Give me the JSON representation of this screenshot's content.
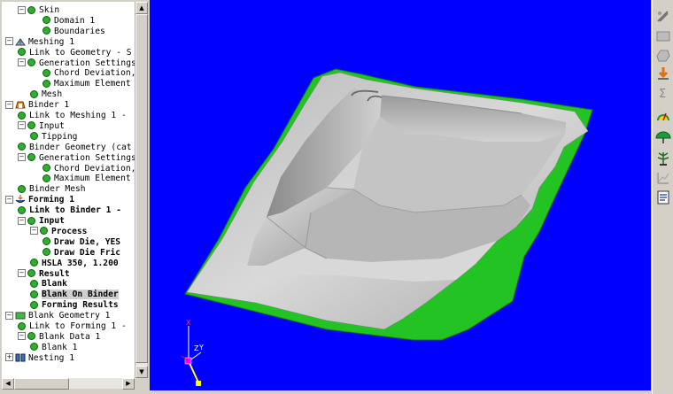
{
  "tree": {
    "items": [
      {
        "label": "Skin",
        "node": "minus",
        "icon": "green-dot-icon"
      },
      {
        "label": "Domain 1",
        "node": "none",
        "icon": "green-dot-icon"
      },
      {
        "label": "Boundaries",
        "node": "none",
        "icon": "green-dot-icon"
      },
      {
        "label": "Meshing 1",
        "node": "minus",
        "icon": "meshing-icon"
      },
      {
        "label": "Link to Geometry - S",
        "node": "none",
        "icon": "green-dot-icon"
      },
      {
        "label": "Generation Settings",
        "node": "minus",
        "icon": "green-dot-icon"
      },
      {
        "label": "Chord Deviation,",
        "node": "none",
        "icon": "green-dot-icon"
      },
      {
        "label": "Maximum Element S",
        "node": "none",
        "icon": "green-dot-icon"
      },
      {
        "label": "Mesh",
        "node": "none",
        "icon": "green-dot-icon"
      },
      {
        "label": "Binder 1",
        "node": "minus",
        "icon": "binder-icon"
      },
      {
        "label": "Link to Meshing 1 -",
        "node": "none",
        "icon": "green-dot-icon"
      },
      {
        "label": "Input",
        "node": "minus",
        "icon": "green-dot-icon"
      },
      {
        "label": "Tipping",
        "node": "none",
        "icon": "green-dot-icon"
      },
      {
        "label": "Binder Geometry (cat",
        "node": "none",
        "icon": "green-dot-icon"
      },
      {
        "label": "Generation Settings",
        "node": "minus",
        "icon": "green-dot-icon"
      },
      {
        "label": "Chord Deviation,",
        "node": "none",
        "icon": "green-dot-icon"
      },
      {
        "label": "Maximum Element S",
        "node": "none",
        "icon": "green-dot-icon"
      },
      {
        "label": "Binder Mesh",
        "node": "none",
        "icon": "green-dot-icon"
      },
      {
        "label": "Forming 1",
        "node": "minus",
        "icon": "forming-icon"
      },
      {
        "label": "Link to Binder 1 -",
        "node": "none",
        "icon": "green-dot-icon"
      },
      {
        "label": "Input",
        "node": "minus",
        "icon": "green-dot-icon"
      },
      {
        "label": "Process",
        "node": "minus",
        "icon": "green-dot-icon"
      },
      {
        "label": "Draw Die, YES",
        "node": "none",
        "icon": "green-dot-icon"
      },
      {
        "label": "Draw Die Fric",
        "node": "none",
        "icon": "green-dot-icon"
      },
      {
        "label": "HSLA 350, 1.200",
        "node": "none",
        "icon": "green-dot-icon"
      },
      {
        "label": "Result",
        "node": "minus",
        "icon": "green-dot-icon"
      },
      {
        "label": "Blank",
        "node": "none",
        "icon": "green-dot-icon"
      },
      {
        "label": "Blank On Binder",
        "node": "none",
        "icon": "green-dot-icon"
      },
      {
        "label": "Forming Results",
        "node": "none",
        "icon": "green-dot-icon"
      },
      {
        "label": "Blank Geometry 1",
        "node": "minus",
        "icon": "blank-geometry-icon"
      },
      {
        "label": "Link to Forming 1 -",
        "node": "none",
        "icon": "green-dot-icon"
      },
      {
        "label": "Blank Data 1",
        "node": "minus",
        "icon": "green-dot-icon"
      },
      {
        "label": "Blank 1",
        "node": "none",
        "icon": "green-dot-icon"
      },
      {
        "label": "Nesting 1",
        "node": "plus",
        "icon": "nesting-icon"
      }
    ]
  },
  "viewport": {
    "background": "#0000ff",
    "axis_labels": {
      "x": "X",
      "y": "Y",
      "z": "Z"
    }
  },
  "toolbar": {
    "icons": [
      "ruler-icon",
      "panel-icon",
      "shape-icon",
      "download-arrow-icon",
      "sigma-icon",
      "gauge-icon",
      "umbrella-gauge-icon",
      "tree-icon",
      "chart-icon",
      "report-icon"
    ]
  },
  "colors": {
    "flange_green": "#22c322",
    "part_gray": "#c8c8c8",
    "tree_dot": "#2fae2f"
  }
}
